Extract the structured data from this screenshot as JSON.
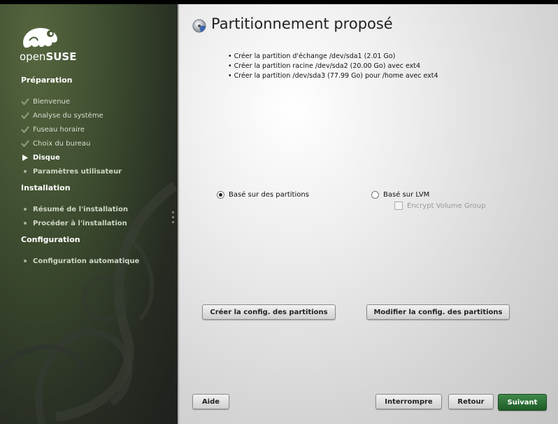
{
  "sidebar": {
    "logo_text_light": "open",
    "logo_text_bold": "SUSE",
    "sections": [
      {
        "title": "Préparation",
        "steps": [
          {
            "label": "Bienvenue",
            "state": "done"
          },
          {
            "label": "Analyse du système",
            "state": "done"
          },
          {
            "label": "Fuseau horaire",
            "state": "done"
          },
          {
            "label": "Choix du bureau",
            "state": "done"
          },
          {
            "label": "Disque",
            "state": "current"
          },
          {
            "label": "Paramètres utilisateur",
            "state": "pending"
          }
        ]
      },
      {
        "title": "Installation",
        "steps": [
          {
            "label": "Résumé de l'installation",
            "state": "pending"
          },
          {
            "label": "Procéder à l'installation",
            "state": "pending"
          }
        ]
      },
      {
        "title": "Configuration",
        "steps": [
          {
            "label": "Configuration automatique",
            "state": "pending"
          }
        ]
      }
    ]
  },
  "main": {
    "title": "Partitionnement proposé",
    "summary": [
      "Créer la partition d'échange /dev/sda1 (2.01 Go)",
      "Créer la partition racine /dev/sda2 (20.00 Go) avec ext4",
      "Créer la partition /dev/sda3 (77.99 Go) pour /home avec ext4"
    ],
    "radio_partitions": {
      "label": "Basé sur des partitions",
      "checked": true
    },
    "radio_lvm": {
      "label": "Basé sur LVM",
      "checked": false
    },
    "encrypt_vg": {
      "label": "Encrypt Volume Group",
      "checked": false,
      "enabled": false
    },
    "create_btn": "Créer la config. des partitions",
    "modify_btn": "Modifier la config. des partitions"
  },
  "footer": {
    "help": "Aide",
    "abort": "Interrompre",
    "back": "Retour",
    "next": "Suivant"
  },
  "colors": {
    "accent_green": "#2e6b37",
    "sidebar_dark": "#262b22"
  },
  "icons": {
    "done": "check-icon",
    "current": "play-arrow-icon",
    "pending": "bullet-icon",
    "title": "disk-icon"
  }
}
